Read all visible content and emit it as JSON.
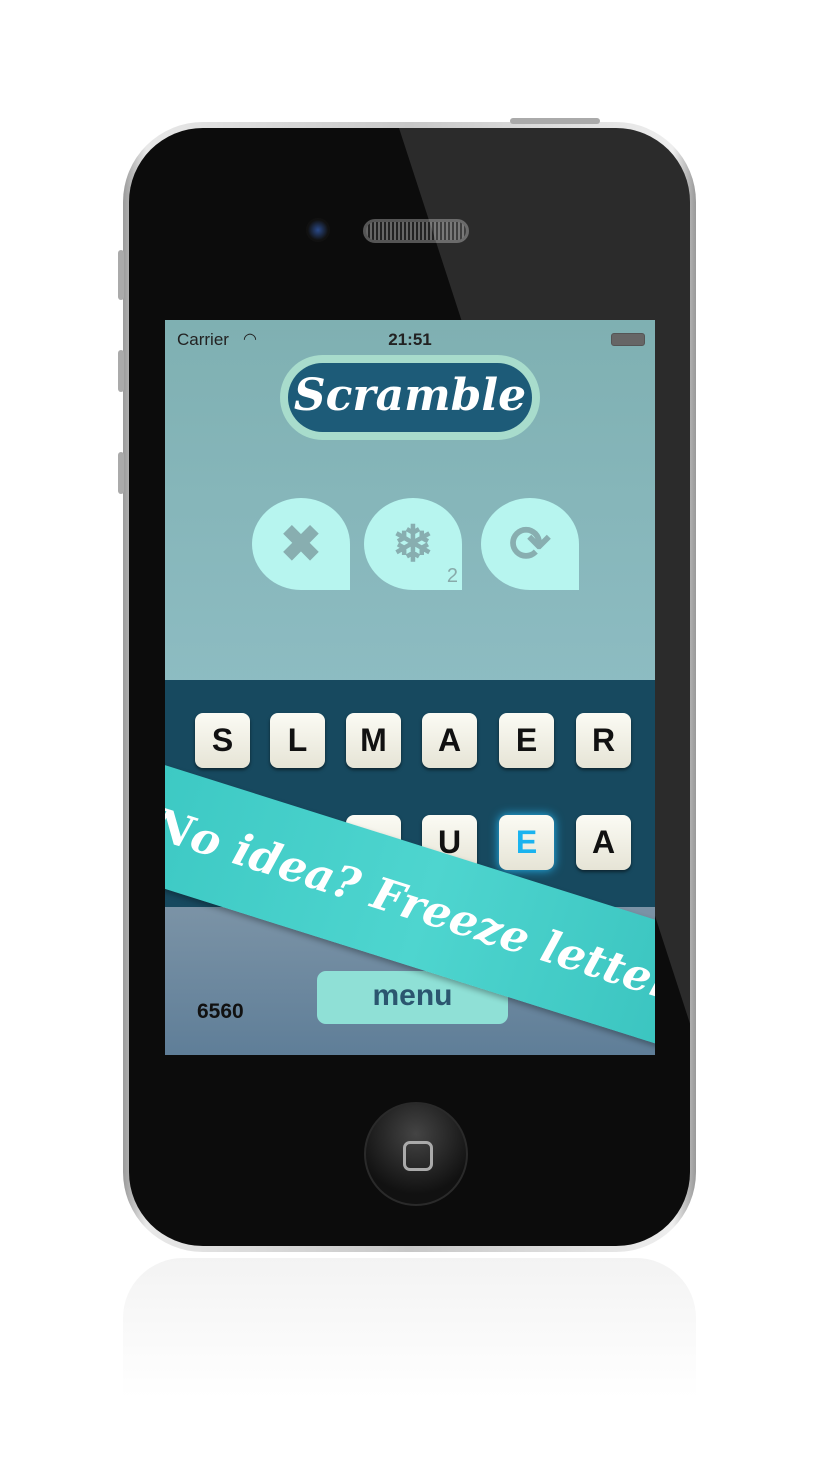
{
  "status_bar": {
    "carrier": "Carrier",
    "time": "21:51",
    "wifi_icon": "wifi-icon",
    "battery_icon": "battery-icon"
  },
  "logo": {
    "text": "Scramble"
  },
  "actions": [
    {
      "name": "clear",
      "icon": "close-icon",
      "glyph": "✖"
    },
    {
      "name": "freeze",
      "icon": "snowflake-icon",
      "glyph": "❄",
      "count": "2"
    },
    {
      "name": "shuffle",
      "icon": "refresh-icon",
      "glyph": "⟳"
    }
  ],
  "board": {
    "row1": [
      "S",
      "L",
      "M",
      "A",
      "E",
      "R"
    ],
    "row2": [
      "",
      "",
      "",
      "U",
      "E",
      "A"
    ],
    "frozen_color": "#1ab3ef"
  },
  "footer": {
    "score": "6560",
    "menu_label": "menu"
  },
  "banner": {
    "text": "No idea? Freeze letters"
  }
}
